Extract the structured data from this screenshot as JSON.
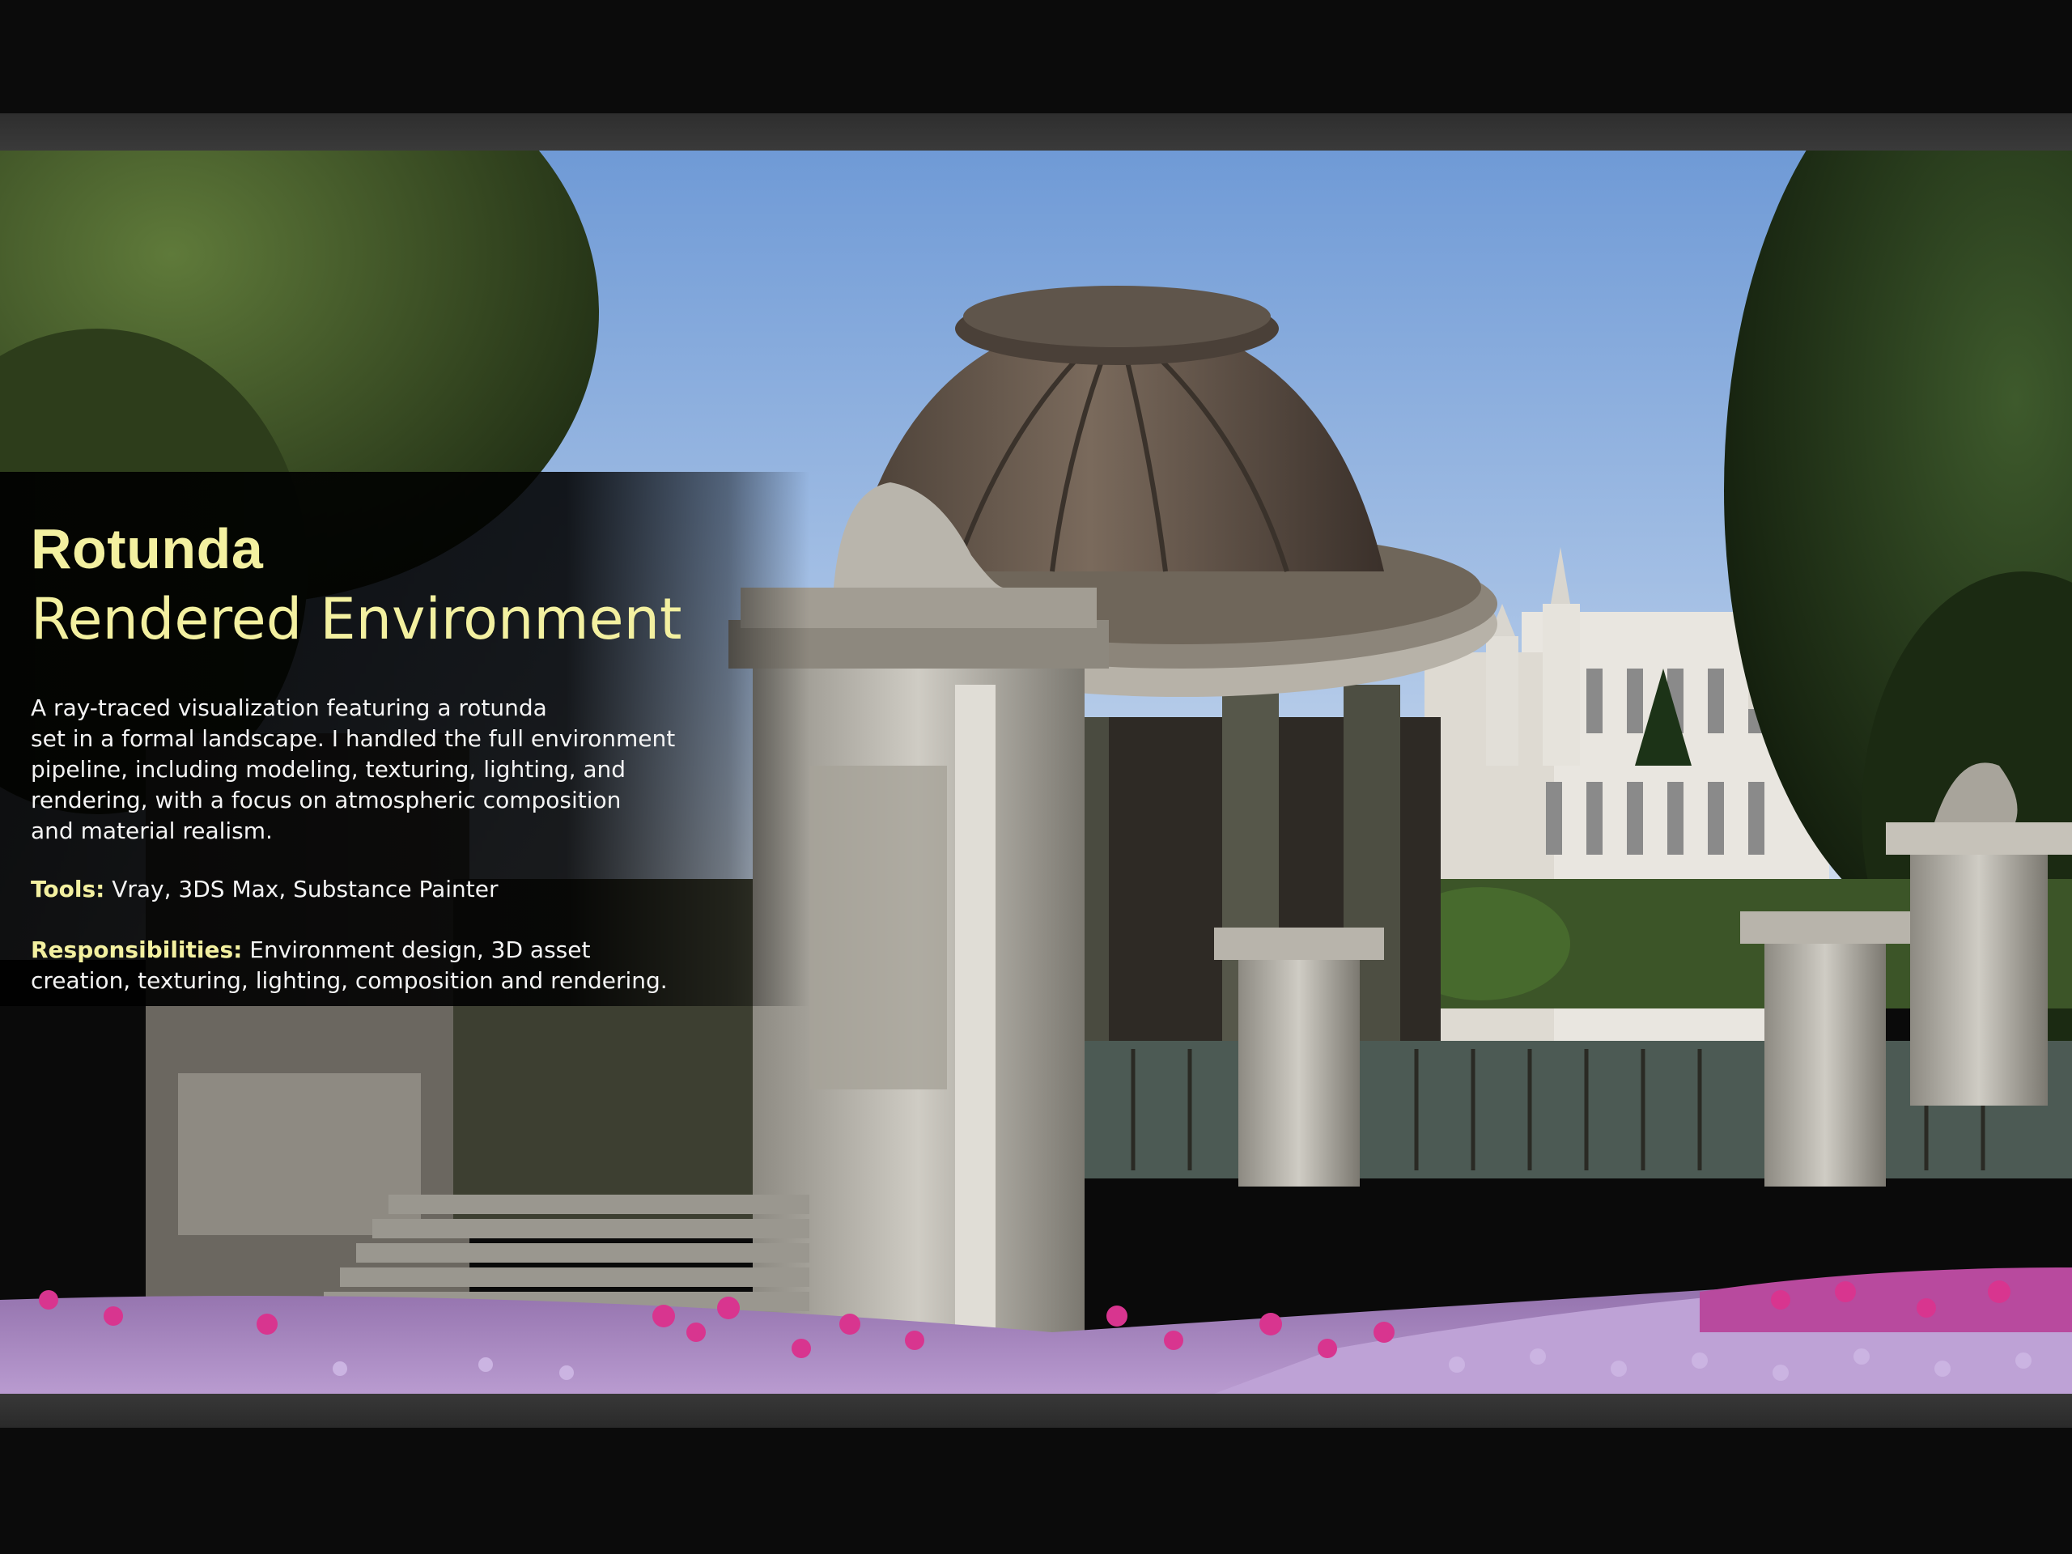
{
  "project": {
    "title": "Rotunda",
    "subtitle": "Rendered Environment",
    "description": "A ray-traced visualization featuring a rotunda\nset in a formal landscape. I handled the full environment\npipeline, including modeling, texturing, lighting, and\nrendering, with a focus on atmospheric composition\nand material realism.",
    "tools_label": "Tools:",
    "tools_value": " Vray, 3DS Max, Substance Painter",
    "responsibilities_label": "Responsibilities:",
    "responsibilities_value": " Environment design, 3D asset\ncreation, texturing, lighting, composition and rendering."
  },
  "colors": {
    "accent": "#f3f0a0",
    "text": "#f4f4f4",
    "panel": "#000000",
    "sky": "#7fa6dc",
    "flowers_pink": "#d23c9a",
    "flowers_lilac": "#b58fd6"
  },
  "scene": {
    "image_subject": "rotunda-rendered-environment"
  }
}
